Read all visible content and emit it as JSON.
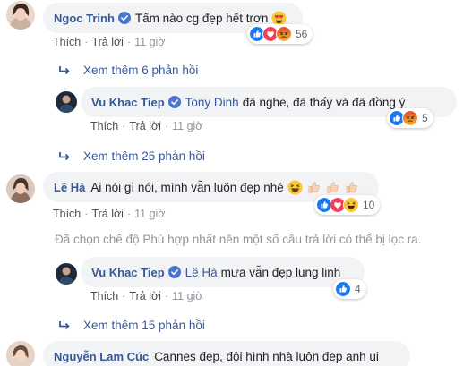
{
  "comment1": {
    "author": "Ngoc Trinh",
    "text": "Tấm nào cg đẹp hết trơn",
    "actions": {
      "like": "Thích",
      "reply": "Trả lời",
      "time": "11 giờ"
    },
    "reaction_count": "56",
    "reactions": [
      "like-icon",
      "love-icon",
      "angry-icon"
    ]
  },
  "more1": "Xem thêm 6 phản hồi",
  "reply1": {
    "author": "Vu Khac Tiep",
    "mention": "Tony Dinh",
    "text": "đã nghe, đã thấy và đã đồng ý",
    "actions": {
      "like": "Thích",
      "reply": "Trả lời",
      "time": "11 giờ"
    },
    "reaction_count": "5",
    "reactions": [
      "like-icon",
      "angry-icon"
    ]
  },
  "more2": "Xem thêm 25 phản hồi",
  "comment2": {
    "author": "Lê Hà",
    "text": "Ai nói gì nói, mình vẫn luôn đẹp nhé",
    "actions": {
      "like": "Thích",
      "reply": "Trả lời",
      "time": "11 giờ"
    },
    "reaction_count": "10",
    "reactions": [
      "like-icon",
      "love-icon",
      "haha-icon"
    ]
  },
  "filtered_notice": "Đã chọn chế độ Phù hợp nhất nên một số câu trả lời có thể bị lọc ra.",
  "reply2": {
    "author": "Vu Khac Tiep",
    "mention": "Lê Hà",
    "text": "mưa vẫn đẹp lung linh",
    "actions": {
      "like": "Thích",
      "reply": "Trả lời",
      "time": "11 giờ"
    },
    "reaction_count": "4",
    "reactions": [
      "like-icon"
    ]
  },
  "more3": "Xem thêm 15 phản hồi",
  "comment3": {
    "author": "Nguyễn Lam Cúc",
    "text": "Cannes đẹp, đội hình nhà luôn đẹp anh ui"
  },
  "colors": {
    "link": "#385898",
    "bubble": "#f2f3f5",
    "like": "#1877f2",
    "love": "#f33e58",
    "angry": "#e9710f"
  }
}
